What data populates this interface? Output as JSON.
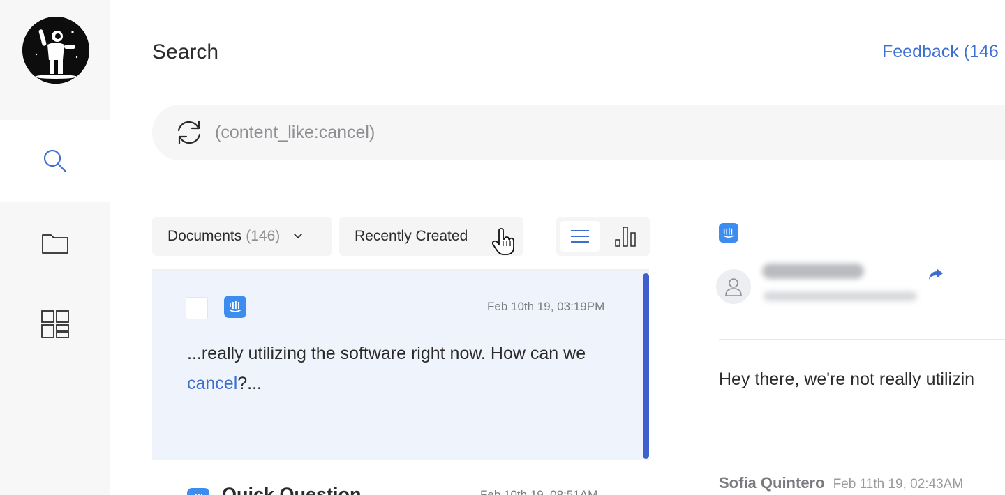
{
  "header": {
    "title": "Search",
    "feedback_link": "Feedback (146"
  },
  "search": {
    "query": "(content_like:cancel)"
  },
  "filters": {
    "documents_label": "Documents",
    "documents_count": "(146)",
    "sort_label": "Recently Created"
  },
  "results": [
    {
      "date": "Feb 10th 19, 03:19PM",
      "snippet_before": "...really utilizing the software right now. How can we ",
      "snippet_highlight": "cancel",
      "snippet_after": "?...",
      "source_icon": "intercom-icon"
    },
    {
      "title": "Quick Question",
      "date": "Feb 10th 19, 08:51AM",
      "source_icon": "intercom-icon"
    }
  ],
  "detail": {
    "message": "Hey there, we're not really utilizin",
    "author_name": "Sofia Quintero",
    "author_date": "Feb 11th 19, 02:43AM"
  },
  "colors": {
    "accent": "#3d6fd1",
    "intercom": "#3d8cf0",
    "selected_card": "#eff3fb",
    "scroll_thumb": "#3f5fcf"
  }
}
